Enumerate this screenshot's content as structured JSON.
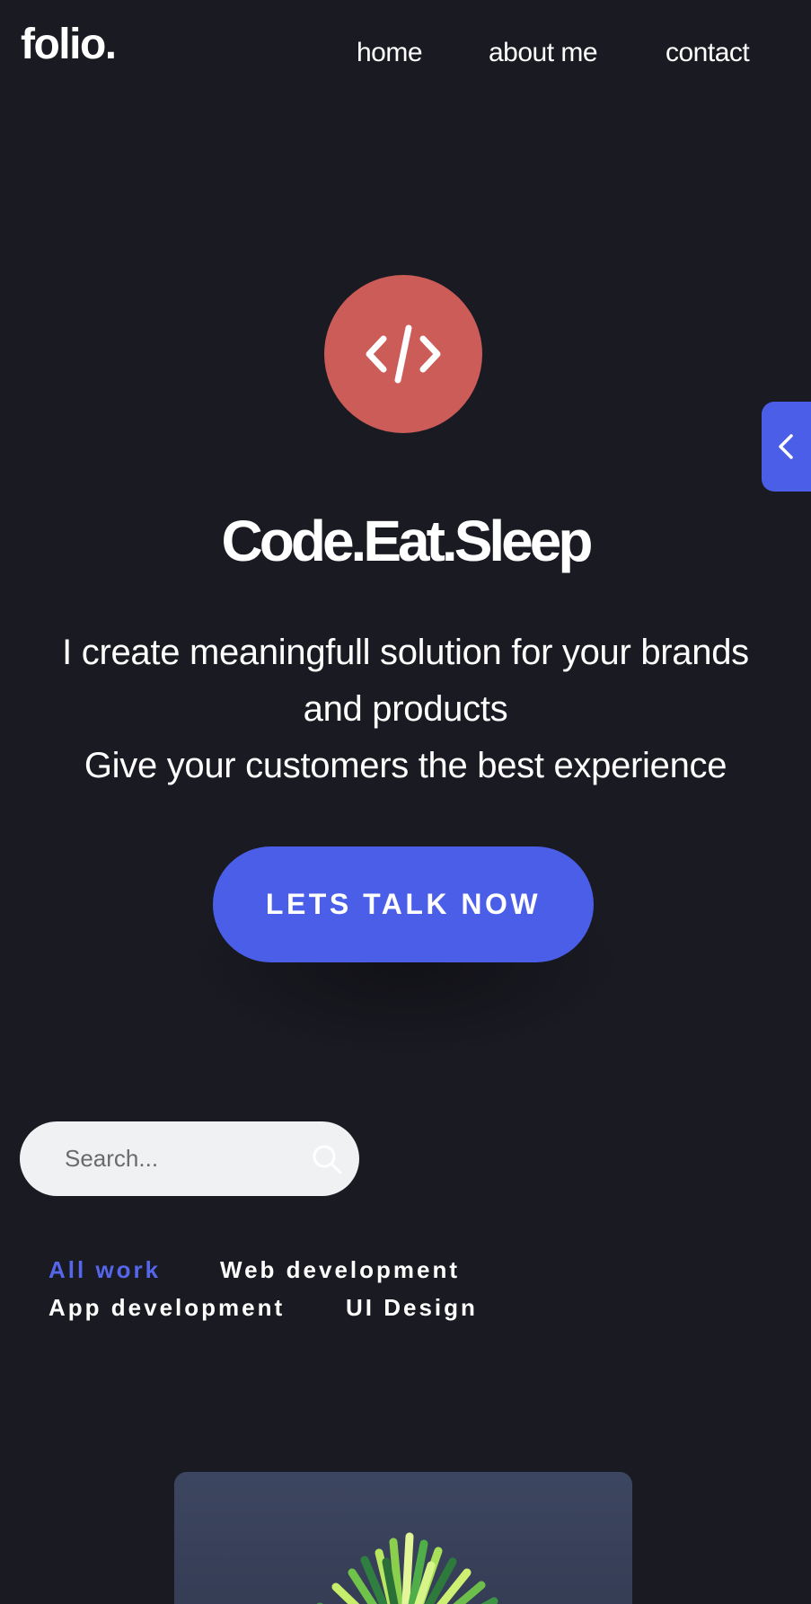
{
  "header": {
    "logo": "folio.",
    "nav": [
      {
        "label": "home"
      },
      {
        "label": "about me"
      },
      {
        "label": "contact"
      }
    ]
  },
  "side_tab": {
    "icon": "chevron-left-icon"
  },
  "hero": {
    "icon": "code-icon",
    "title": "Code.Eat.Sleep",
    "lines": [
      "I create meaningfull solution for your brands",
      "and products",
      "Give your customers the best experience"
    ],
    "cta_label": "LETS TALK NOW"
  },
  "search": {
    "placeholder": "Search...",
    "icon": "search-icon"
  },
  "filters": [
    {
      "label": "All work",
      "active": true
    },
    {
      "label": "Web development",
      "active": false
    },
    {
      "label": "App development",
      "active": false
    },
    {
      "label": "UI Design",
      "active": false
    }
  ],
  "colors": {
    "background": "#1a1a22",
    "accent": "#4b5ee8",
    "hero_icon": "#cc5c58"
  }
}
